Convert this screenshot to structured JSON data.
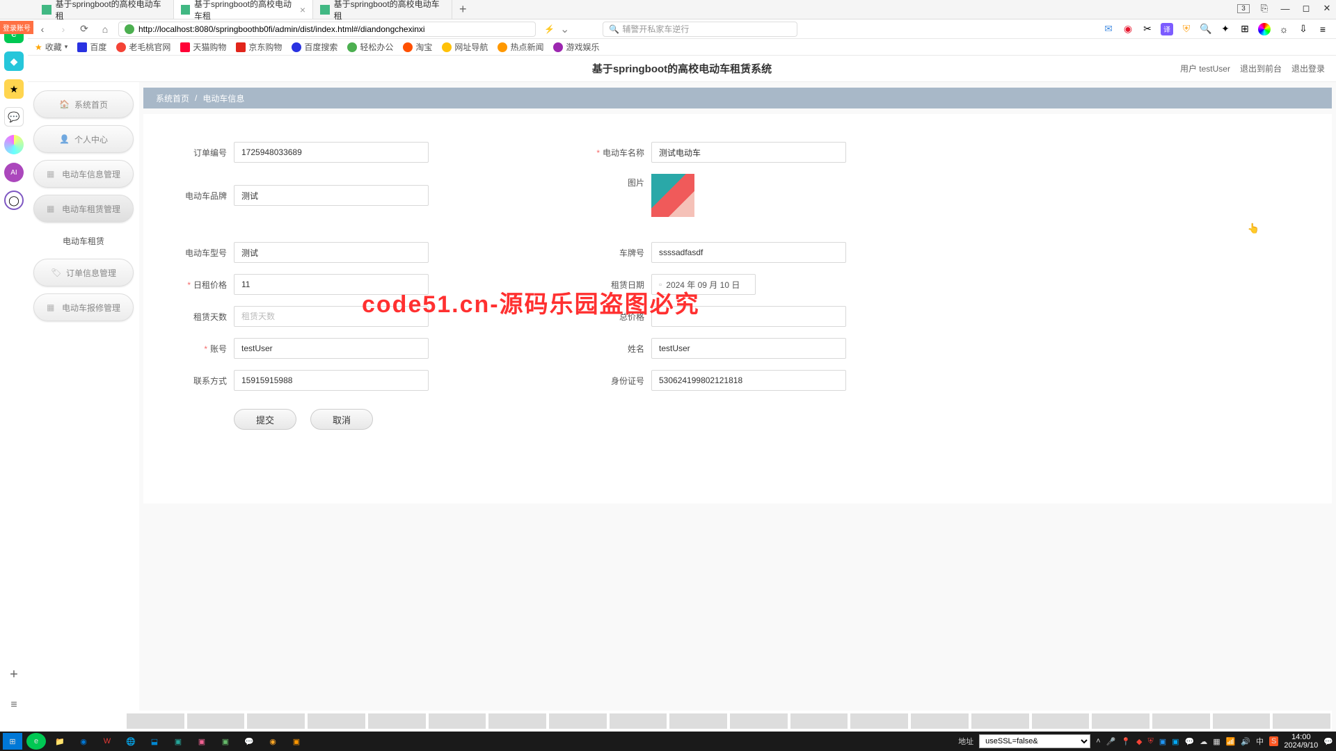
{
  "browser": {
    "tabs": [
      {
        "title": "基于springboot的高校电动车租"
      },
      {
        "title": "基于springboot的高校电动车租"
      },
      {
        "title": "基于springboot的高校电动车租"
      }
    ],
    "url": "http://localhost:8080/springboothb0fi/admin/dist/index.html#/diandongchexinxi",
    "search_placeholder": "辅警开私家车逆行",
    "tab_counter": "3"
  },
  "bookmarks": {
    "fav_label": "收藏",
    "items": [
      "百度",
      "老毛桃官网",
      "天猫购物",
      "京东购物",
      "百度搜索",
      "轻松办公",
      "淘宝",
      "网址导航",
      "热点新闻",
      "游戏娱乐"
    ]
  },
  "login_badge": "登录账号",
  "app": {
    "title": "基于springboot的高校电动车租赁系统",
    "user_label": "用户 testUser",
    "exit_front": "退出到前台",
    "logout": "退出登录"
  },
  "sidebar": {
    "home": "系统首页",
    "personal": "个人中心",
    "bike_info": "电动车信息管理",
    "bike_rent": "电动车租赁管理",
    "bike_rent_sub": "电动车租赁",
    "order_mgmt": "订单信息管理",
    "repair_mgmt": "电动车报修管理"
  },
  "breadcrumb": {
    "home": "系统首页",
    "current": "电动车信息"
  },
  "form": {
    "labels": {
      "order_no": "订单编号",
      "bike_name": "电动车名称",
      "bike_brand": "电动车品牌",
      "image": "图片",
      "bike_model": "电动车型号",
      "plate_no": "车牌号",
      "daily_price": "日租价格",
      "rent_date": "租赁日期",
      "rent_days": "租赁天数",
      "total_price": "总价格",
      "account": "账号",
      "name": "姓名",
      "phone": "联系方式",
      "id_card": "身份证号"
    },
    "values": {
      "order_no": "1725948033689",
      "bike_name": "测试电动车",
      "bike_brand": "测试",
      "bike_model": "测试",
      "plate_no": "ssssadfasdf",
      "daily_price": "11",
      "rent_date": "2024 年 09 月 10 日",
      "rent_days_placeholder": "租赁天数",
      "account": "testUser",
      "name": "testUser",
      "phone": "15915915988",
      "id_card": "530624199802121818"
    },
    "buttons": {
      "submit": "提交",
      "cancel": "取消"
    }
  },
  "watermark": "code51.cn-源码乐园盗图必究",
  "statusbar": {
    "addr_label": "地址",
    "select_value": "useSSL=false&",
    "time": "14:00",
    "date": "2024/9/10",
    "ime": "中"
  }
}
